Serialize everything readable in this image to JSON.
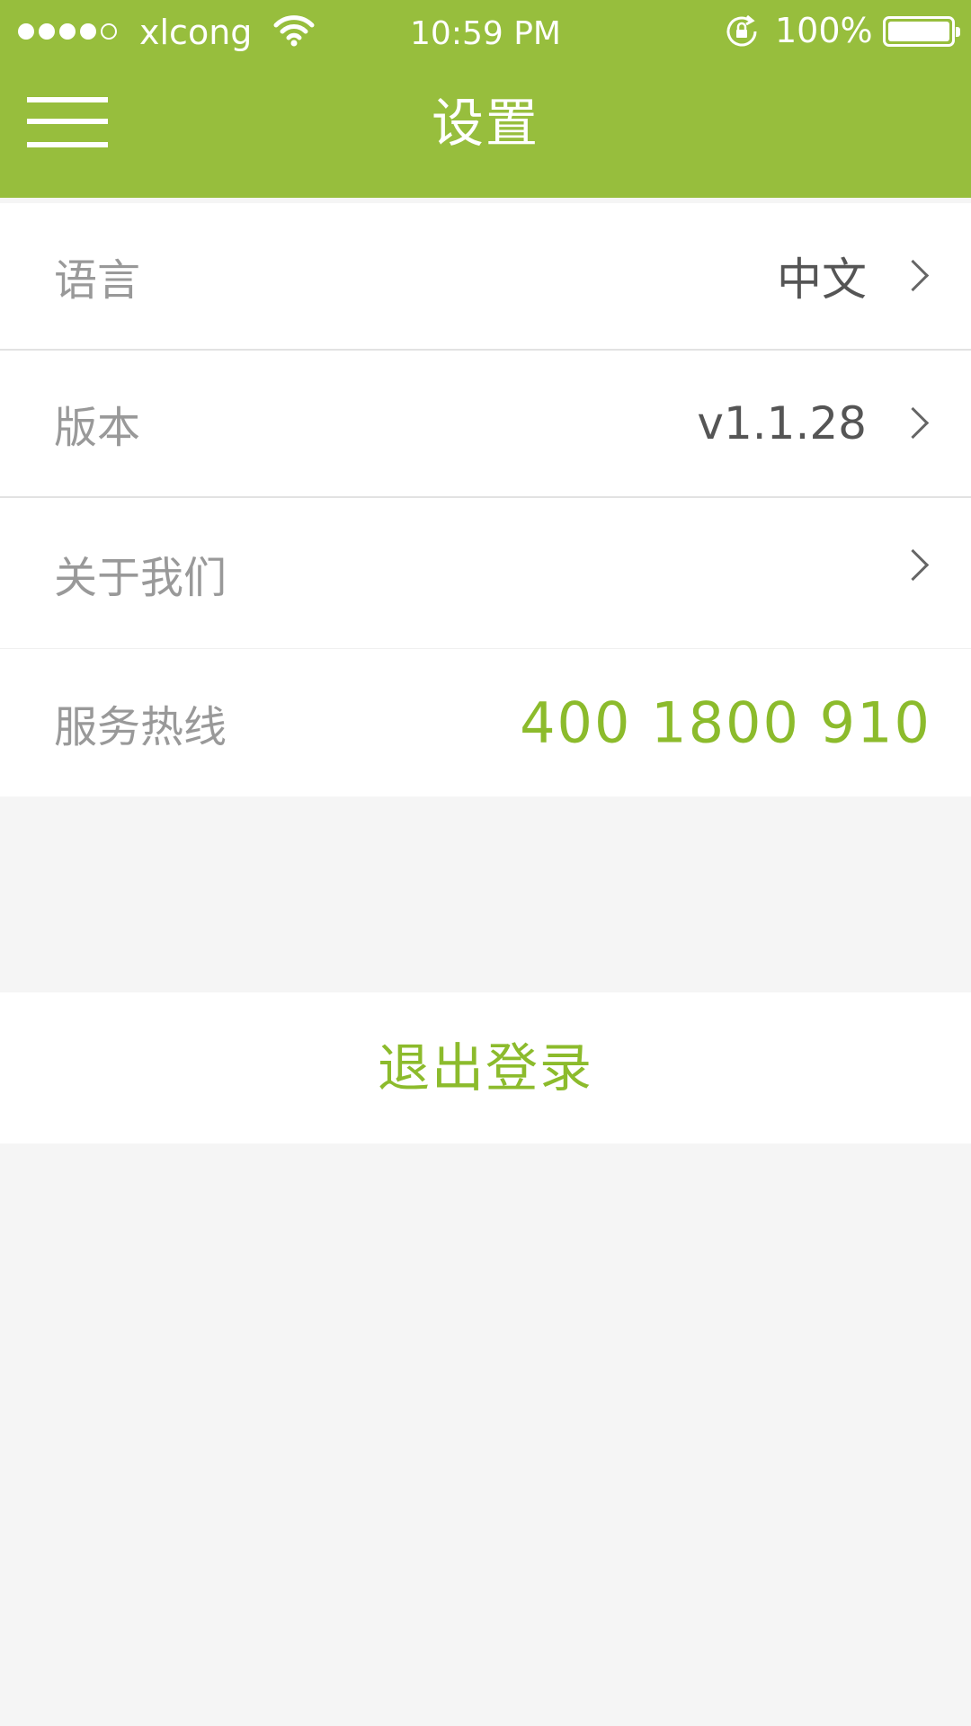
{
  "status_bar": {
    "carrier": "xlcong",
    "time": "10:59 PM",
    "battery_percent": "100%",
    "signal_bars_filled": 4,
    "signal_bars_total": 5
  },
  "header": {
    "title": "设置",
    "background_color": "#97be3d"
  },
  "settings": {
    "language": {
      "label": "语言",
      "value": "中文"
    },
    "version": {
      "label": "版本",
      "value": "v1.1.28"
    },
    "about": {
      "label": "关于我们"
    },
    "hotline": {
      "label": "服务热线",
      "value": "400 1800 910"
    }
  },
  "logout": {
    "label": "退出登录"
  },
  "accent_color": "#8cbb2c"
}
